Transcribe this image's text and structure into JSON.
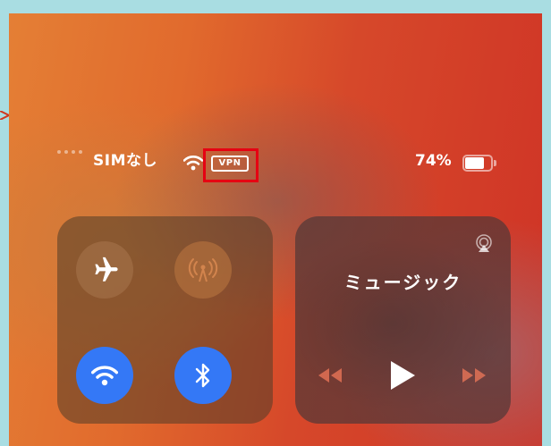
{
  "status_bar": {
    "carrier": "SIMなし",
    "vpn_label": "VPN",
    "battery_percent": "74%",
    "battery_level": 0.74
  },
  "connectivity": {
    "airplane": {
      "icon": "airplane-icon",
      "state": "off"
    },
    "cellular": {
      "icon": "cellular-antenna-icon",
      "state": "disabled"
    },
    "wifi": {
      "icon": "wifi-icon",
      "state": "on"
    },
    "bluetooth": {
      "icon": "bluetooth-icon",
      "state": "on"
    }
  },
  "media": {
    "title": "ミュージック",
    "airplay_icon": "airplay-icon",
    "controls": [
      "rewind-icon",
      "play-icon",
      "fast-forward-icon"
    ]
  },
  "colors": {
    "highlight": "#e60012",
    "toggle_on": "#3478f6",
    "page_border": "#a9dde2"
  }
}
